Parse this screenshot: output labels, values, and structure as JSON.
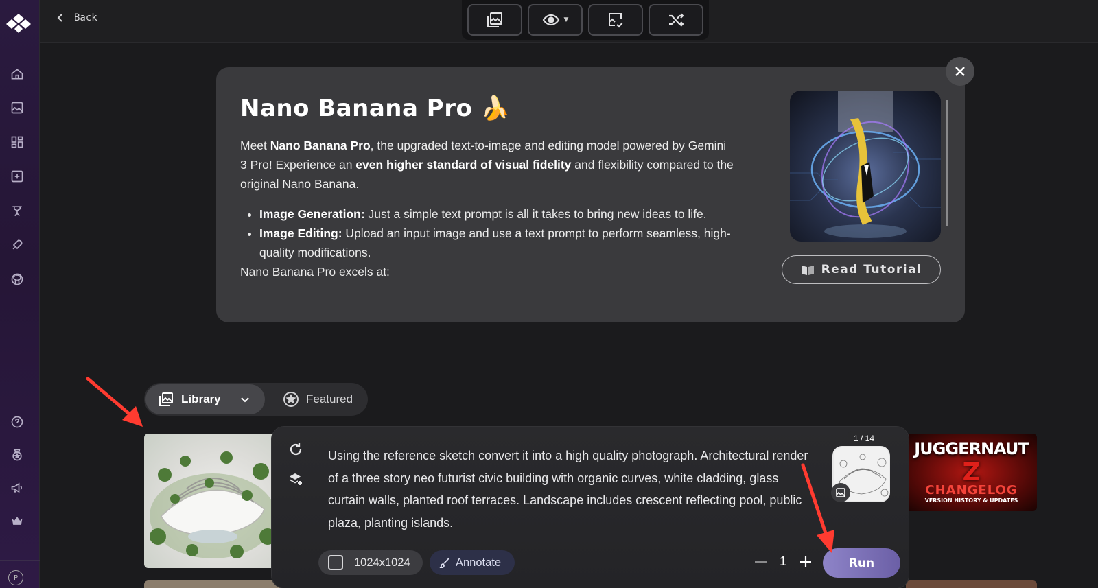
{
  "topbar": {
    "back_label": "Back"
  },
  "card": {
    "title": "Nano Banana Pro",
    "title_emoji": "🍌",
    "intro_pre": "Meet ",
    "intro_bold1": "Nano Banana Pro",
    "intro_mid": ", the upgraded text-to-image and editing model powered by Gemini 3 Pro! Experience an ",
    "intro_bold2": "even higher standard of visual fidelity",
    "intro_post": " and flexibility compared to the original Nano Banana.",
    "bullets": [
      {
        "title": "Image Generation:",
        "text": " Just a simple text prompt is all it takes to bring new ideas to life."
      },
      {
        "title": "Image Editing:",
        "text": " Upload an input image and use a text prompt to perform seamless, high-quality modifications."
      }
    ],
    "excels": "Nano Banana Pro excels at:",
    "tutorial_label": "Read Tutorial"
  },
  "tabs": {
    "library": "Library",
    "featured": "Featured"
  },
  "thumbs": {
    "juggernaut_title": "JUGGERNAUT",
    "juggernaut_z": "Z",
    "juggernaut_sub": "CHANGELOG",
    "juggernaut_sub2": "VERSION HISTORY & UPDATES"
  },
  "prompt": {
    "text": "Using the reference sketch convert it into a high quality photograph. Architectural render of a three story neo futurist civic building with organic curves, white cladding, glass curtain walls, planted roof terraces. Landscape includes crescent reflecting pool, public plaza, planting islands.",
    "ref_counter": "1 / 14",
    "size": "1024x1024",
    "annotate": "Annotate",
    "count": "1",
    "run": "Run"
  },
  "sidebar": {
    "profile_initial": "P",
    "icons": [
      "home-icon",
      "gallery-icon",
      "dashboard-icon",
      "upload-icon",
      "trainer-icon",
      "rocket-icon",
      "github-icon",
      "help-icon",
      "badge-icon",
      "megaphone-icon",
      "crown-icon"
    ]
  },
  "colors": {
    "accent": "#7b6fb8",
    "arrow": "#ff3b30"
  }
}
